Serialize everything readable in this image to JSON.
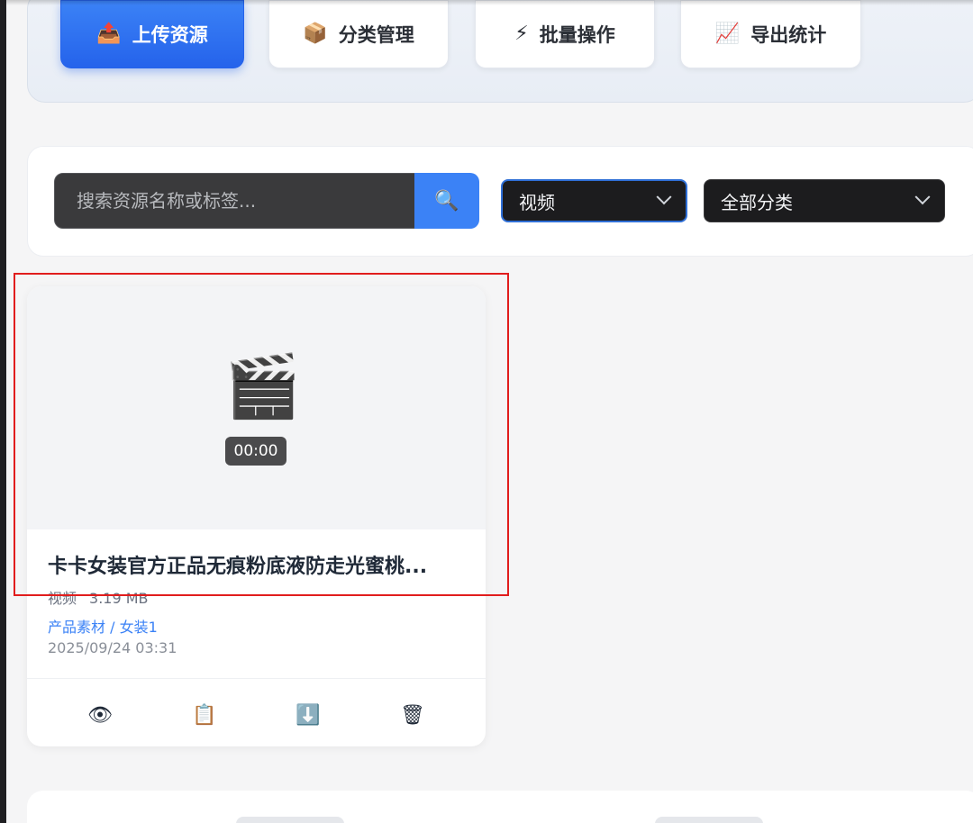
{
  "toolbar": {
    "upload": {
      "icon": "📤",
      "label": "上传资源"
    },
    "category": {
      "icon": "📦",
      "label": "分类管理"
    },
    "batch": {
      "icon": "⚡",
      "label": "批量操作"
    },
    "export": {
      "icon": "📈",
      "label": "导出统计"
    }
  },
  "filters": {
    "search_placeholder": "搜索资源名称或标签...",
    "search_icon": "🔍",
    "type_select": "视频",
    "category_select": "全部分类"
  },
  "card": {
    "thumb_icon": "🎬",
    "duration": "00:00",
    "title": "卡卡女装官方正品无痕粉底液防走光蜜桃...",
    "type": "视频",
    "size": "3.19 MB",
    "category_path": "产品素材 / 女装1",
    "date": "2025/09/24 03:31",
    "actions": {
      "view": "👁",
      "copy": "📋",
      "download": "⬇️",
      "delete": "🗑"
    }
  },
  "colors": {
    "accent": "#3b82f6",
    "highlight": "#e11d1d"
  }
}
